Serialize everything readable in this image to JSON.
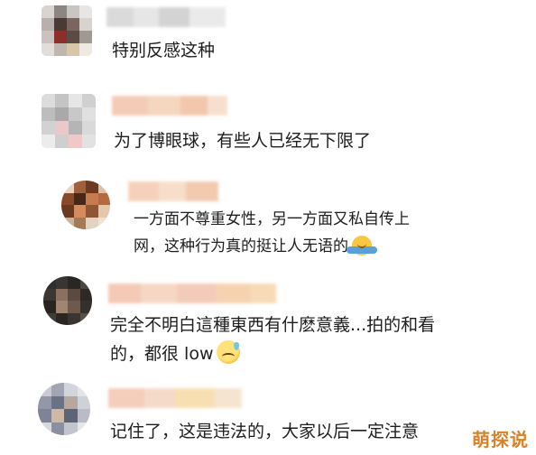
{
  "comments": [
    {
      "username": "",
      "text": "特别反感这种"
    },
    {
      "username": "",
      "text": "为了博眼球，有些人已经无下限了"
    },
    {
      "username": "",
      "text_line1": "一方面不尊重女性，另一方面又私自传上",
      "text_line2": "网，这种行为真的挺让人无语的",
      "emoji": "shrug-emoji"
    },
    {
      "username": "",
      "text_line1": "完全不明白這種東西有什麽意義...拍的和看",
      "text_line2": "的，都很 low",
      "emoji": "sweat-smile-emoji"
    },
    {
      "username": "",
      "text": "记住了，这是违法的，大家以后一定注意"
    }
  ],
  "watermark": "萌探说",
  "colors": {
    "text": "#1e1e1e",
    "watermark": "#d9822b",
    "background": "#ffffff"
  }
}
